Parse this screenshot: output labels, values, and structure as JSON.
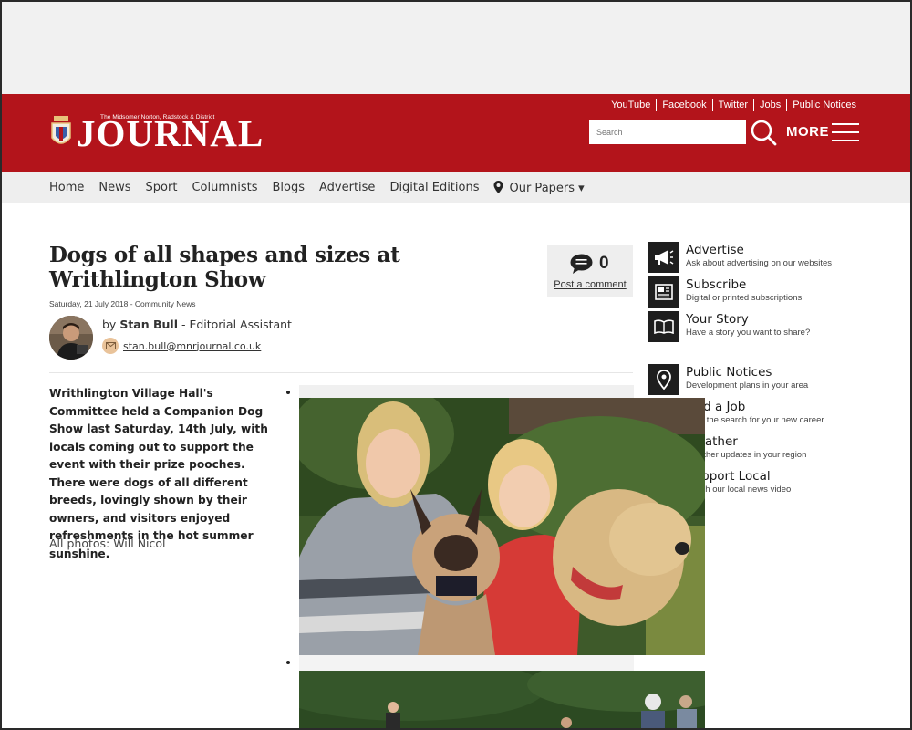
{
  "header": {
    "logo_subtitle": "The Midsomer Norton, Radstock & District",
    "logo_title": "JOURNAL",
    "top_links": [
      "YouTube",
      "Facebook",
      "Twitter",
      "Jobs",
      "Public Notices"
    ],
    "search_placeholder": "Search",
    "more_label": "MORE"
  },
  "nav": {
    "items": [
      "Home",
      "News",
      "Sport",
      "Columnists",
      "Blogs",
      "Advertise",
      "Digital Editions"
    ],
    "our_papers": "Our Papers ▾"
  },
  "article": {
    "headline": "Dogs of all shapes and sizes at Writhlington Show",
    "date": "Saturday, 21 July 2018",
    "date_sep": " - ",
    "category": "Community News",
    "comment_count": "0",
    "post_comment": "Post a comment",
    "author_prefix": "by ",
    "author_name": "Stan Bull",
    "author_role": " - Editorial Assistant",
    "author_email": "stan.bull@mnrjournal.co.uk",
    "lead": "Writhlington Village Hall's Committee held a Companion Dog Show last Saturday, 14th July, with locals coming out to support the event with their prize pooches. There were dogs of all different breeds, lovingly shown by their owners, and visitors enjoyed refreshments in the hot summer sunshine.",
    "photo_credit": "All photos: Will Nicol"
  },
  "sidebar": {
    "advertise": {
      "title": "Advertise",
      "sub": "Ask about advertising on our websites",
      "icon": "megaphone-icon"
    },
    "subscribe": {
      "title": "Subscribe",
      "sub": "Digital or printed subscriptions",
      "icon": "newspaper-icon"
    },
    "your_story": {
      "title": "Your Story",
      "sub": "Have a story you want to share?",
      "icon": "book-icon"
    },
    "public_notices": {
      "title": "Public Notices",
      "sub": "Development plans in your area",
      "icon": "location-pin-icon"
    },
    "find_job": {
      "title": "Find a Job",
      "sub": "Start the search for your new career",
      "icon": "briefcase-icon"
    },
    "weather": {
      "title": "Weather",
      "sub": "Weather updates in your region",
      "icon": "cloud-icon"
    },
    "support_local": {
      "title": "Support Local",
      "sub": "Watch our local news video",
      "icon": "video-icon"
    }
  },
  "colors": {
    "brand_red": "#b3141b",
    "nav_bg": "#eeeeee",
    "icon_bg": "#1e1e1e"
  }
}
